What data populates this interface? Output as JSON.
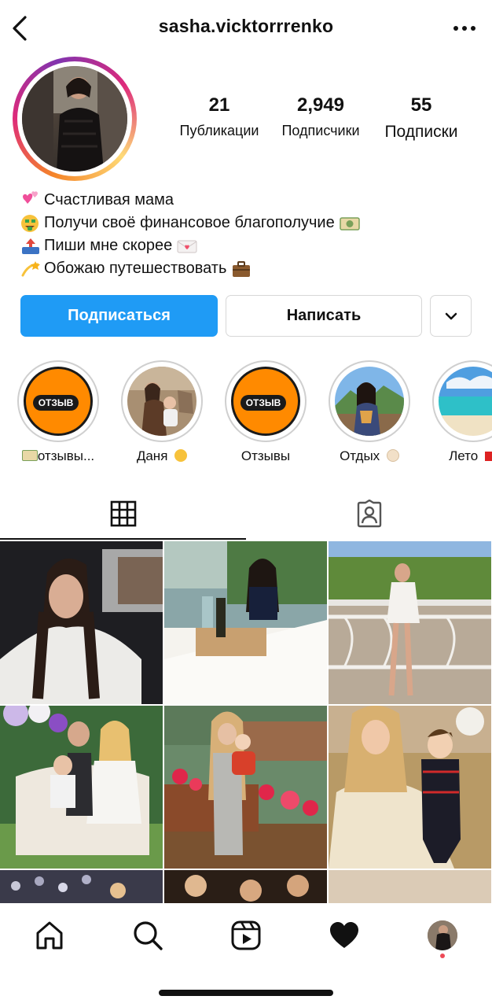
{
  "header": {
    "username": "sasha.vicktorrrenko",
    "back_icon": "chevron-left-icon",
    "more_icon": "more-horizontal-icon"
  },
  "stats": {
    "posts": {
      "value": "21",
      "label": "Публикации"
    },
    "followers": {
      "value": "2,949",
      "label": "Подписчики"
    },
    "following": {
      "value": "55",
      "label": "Подписки"
    }
  },
  "bio": {
    "line1": "Счастливая мама",
    "line2": "Получи своё финансовое благополучие",
    "line3": "Пиши мне скорее",
    "line4": "Обожаю путешествовать",
    "emojis": [
      "two-hearts",
      "money-mouth-face",
      "outbox-tray",
      "money-bill",
      "love-letter",
      "dizzy",
      "briefcase"
    ]
  },
  "actions": {
    "follow": "Подписаться",
    "message": "Написать",
    "more_icon": "chevron-down-icon"
  },
  "highlights": [
    {
      "label": "отзывы...",
      "cover_text": "ОТЗЫВ"
    },
    {
      "label": "Даня"
    },
    {
      "label": "Отзывы",
      "cover_text": "ОТЗЫВ"
    },
    {
      "label": "Отдых"
    },
    {
      "label": "Лето"
    }
  ],
  "tabs": [
    {
      "name": "posts-grid",
      "icon": "grid-icon",
      "active": true
    },
    {
      "name": "tagged",
      "icon": "tagged-user-icon",
      "active": false
    }
  ],
  "bottom_nav": [
    {
      "name": "home",
      "icon": "home-icon"
    },
    {
      "name": "search",
      "icon": "search-icon"
    },
    {
      "name": "reels",
      "icon": "reels-icon"
    },
    {
      "name": "activity",
      "icon": "heart-icon"
    },
    {
      "name": "profile",
      "icon": "avatar"
    }
  ],
  "colors": {
    "primary_button": "#1f9bf5",
    "highlight_orange": "#ff8a00",
    "notification_dot": "#ed4956"
  }
}
